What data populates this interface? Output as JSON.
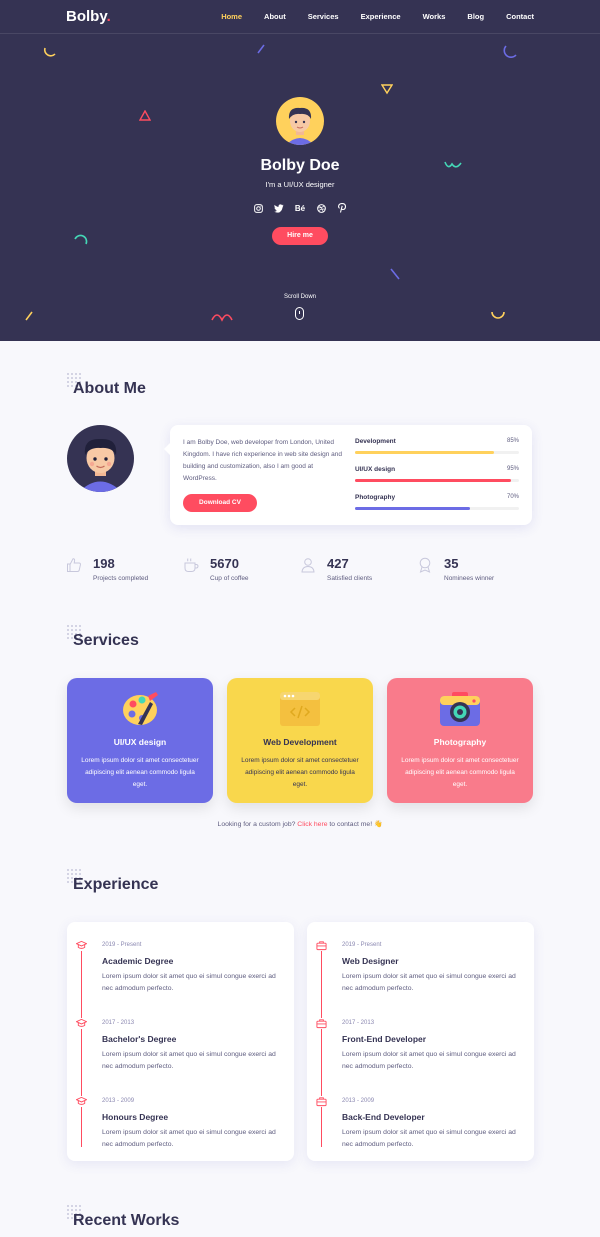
{
  "nav": {
    "logo": "Bolby",
    "logo_dot": ".",
    "items": [
      {
        "label": "Home",
        "active": true
      },
      {
        "label": "About",
        "active": false
      },
      {
        "label": "Services",
        "active": false
      },
      {
        "label": "Experience",
        "active": false
      },
      {
        "label": "Works",
        "active": false
      },
      {
        "label": "Blog",
        "active": false
      },
      {
        "label": "Contact",
        "active": false
      }
    ]
  },
  "hero": {
    "name": "Bolby Doe",
    "subtitle": "I'm a UI/UX designer",
    "socials": [
      "instagram-icon",
      "twitter-icon",
      "behance-icon",
      "dribbble-icon",
      "pinterest-icon"
    ],
    "behance_text": "Bé",
    "hire_label": "Hire me",
    "scroll_label": "Scroll Down"
  },
  "about": {
    "title": "About Me",
    "text": "I am Bolby Doe, web developer from London, United Kingdom. I have rich experience in web site design and building and customization, also I am good at WordPress.",
    "download_label": "Download CV",
    "skills": [
      {
        "name": "Development",
        "percent": 85,
        "pct_label": "85%",
        "color": "#ffd15c"
      },
      {
        "name": "UI/UX design",
        "percent": 95,
        "pct_label": "95%",
        "color": "#ff4c60"
      },
      {
        "name": "Photography",
        "percent": 70,
        "pct_label": "70%",
        "color": "#6c6ce5"
      }
    ],
    "facts": [
      {
        "icon": "like-icon",
        "number": "198",
        "label": "Projects completed"
      },
      {
        "icon": "coffee-icon",
        "number": "5670",
        "label": "Cup of coffee"
      },
      {
        "icon": "users-icon",
        "number": "427",
        "label": "Satisfied clients"
      },
      {
        "icon": "badge-icon",
        "number": "35",
        "label": "Nominees winner"
      }
    ]
  },
  "services": {
    "title": "Services",
    "items": [
      {
        "icon": "design-palette-icon",
        "title": "UI/UX design",
        "desc": "Lorem ipsum dolor sit amet consectetuer adipiscing elit aenean commodo ligula eget.",
        "bg": "#6c6ce5",
        "fg": "#ffffff"
      },
      {
        "icon": "code-window-icon",
        "title": "Web Development",
        "desc": "Lorem ipsum dolor sit amet consectetuer adipiscing elit aenean commodo ligula eget.",
        "bg": "#f9d74c",
        "fg": "#353353"
      },
      {
        "icon": "camera-icon",
        "title": "Photography",
        "desc": "Lorem ipsum dolor sit amet consectetuer adipiscing elit aenean commodo ligula eget.",
        "bg": "#f97b8b",
        "fg": "#ffffff"
      }
    ],
    "cta_prefix": "Looking for a custom job?",
    "cta_link": "Click here",
    "cta_suffix": "to contact me! 👋"
  },
  "experience": {
    "title": "Experience",
    "education": [
      {
        "date": "2019 - Present",
        "title": "Academic Degree",
        "desc": "Lorem ipsum dolor sit amet quo ei simul congue exerci ad nec admodum perfecto."
      },
      {
        "date": "2017 - 2013",
        "title": "Bachelor's Degree",
        "desc": "Lorem ipsum dolor sit amet quo ei simul congue exerci ad nec admodum perfecto."
      },
      {
        "date": "2013 - 2009",
        "title": "Honours Degree",
        "desc": "Lorem ipsum dolor sit amet quo ei simul congue exerci ad nec admodum perfecto."
      }
    ],
    "work": [
      {
        "date": "2019 - Present",
        "title": "Web Designer",
        "desc": "Lorem ipsum dolor sit amet quo ei simul congue exerci ad nec admodum perfecto."
      },
      {
        "date": "2017 - 2013",
        "title": "Front-End Developer",
        "desc": "Lorem ipsum dolor sit amet quo ei simul congue exerci ad nec admodum perfecto."
      },
      {
        "date": "2013 - 2009",
        "title": "Back-End Developer",
        "desc": "Lorem ipsum dolor sit amet quo ei simul congue exerci ad nec admodum perfecto."
      }
    ]
  },
  "works": {
    "title": "Recent Works"
  },
  "colors": {
    "primary": "#ff4c60",
    "dark": "#353353",
    "accent_yellow": "#ffd15c",
    "accent_blue": "#6c6ce5"
  }
}
